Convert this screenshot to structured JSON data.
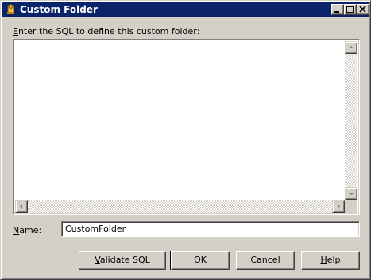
{
  "window": {
    "title": "Custom Folder",
    "title_bar_color": "#0a246a",
    "face_color": "#d4d0c8",
    "icons": [
      "app-icon",
      "minimize-icon",
      "maximize-icon",
      "close-icon"
    ]
  },
  "sql": {
    "label": "Enter the SQL to define this custom folder:",
    "label_access_key": "E",
    "label_rest": "nter the SQL to define this custom folder:",
    "value": ""
  },
  "name": {
    "label": "Name:",
    "label_access_key": "N",
    "label_rest": "ame:",
    "value": "CustomFolder"
  },
  "buttons": {
    "validate": {
      "label": "Validate SQL",
      "access_key": "V",
      "rest": "alidate SQL"
    },
    "ok": {
      "label": "OK"
    },
    "cancel": {
      "label": "Cancel"
    },
    "help": {
      "label": "Help",
      "access_key": "H",
      "rest": "elp"
    }
  }
}
